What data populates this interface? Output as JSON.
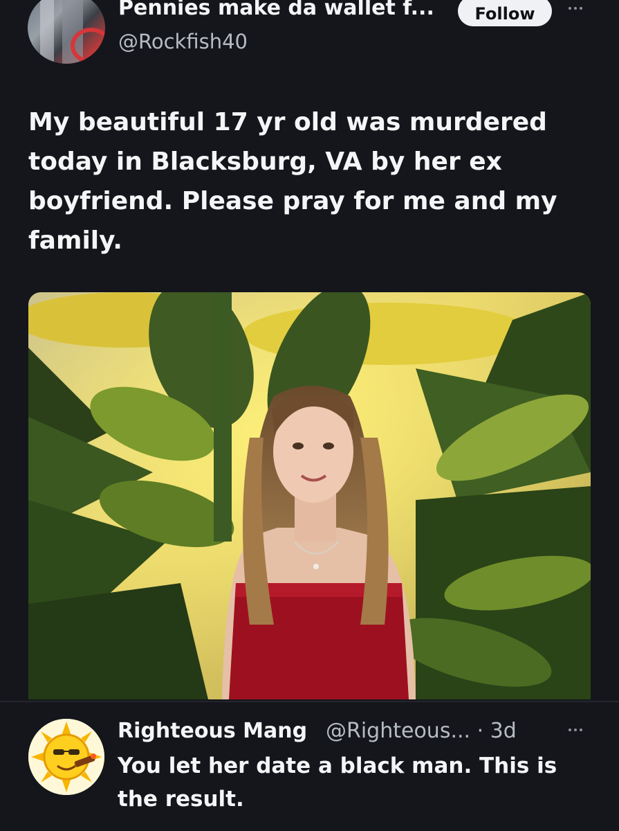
{
  "post": {
    "author": {
      "display_name": "Pennies make da wallet f...",
      "handle": "@Rockfish40",
      "avatar_icon": "profile-photo-avatar"
    },
    "follow_label": "Follow",
    "more_icon": "more-options-icon",
    "text": "My beautiful 17 yr old was murdered today in Blacksburg, VA by her ex boyfriend.  Please pray for me and my family.",
    "media": {
      "type": "photo",
      "icon": "photo-image"
    }
  },
  "reply": {
    "author": {
      "display_name": "Righteous Mang",
      "handle_time": "@Righteous... · 3d",
      "avatar_icon": "cartoon-sun-avatar"
    },
    "more_icon": "more-options-icon",
    "text": "You let her date a black man. This is the result."
  },
  "colors": {
    "background": "#14161b",
    "text_primary": "#f4f5f7",
    "text_secondary": "#b7bcc4",
    "follow_button_bg": "#eff1f4"
  }
}
